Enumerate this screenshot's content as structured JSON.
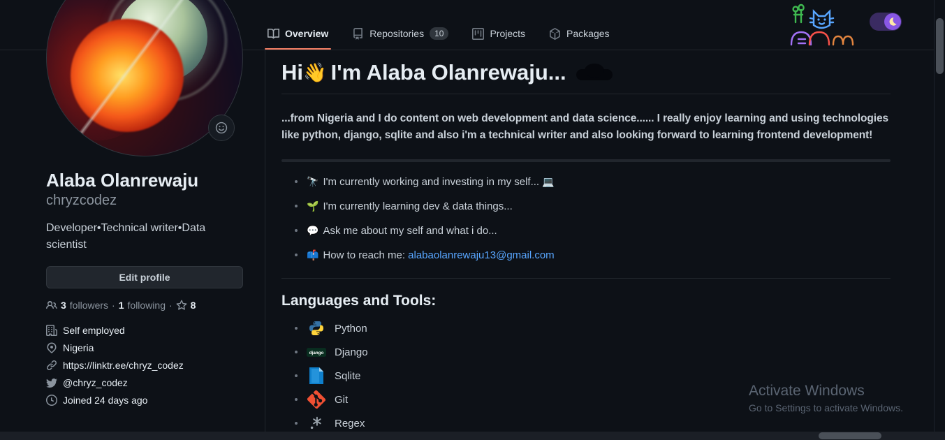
{
  "header": {
    "theme_toggle_icon": "moon-icon",
    "doodle_icon": "github-neon-doodle"
  },
  "nav": {
    "items": [
      {
        "label": "Overview",
        "icon": "book-icon",
        "badge": "",
        "active": true
      },
      {
        "label": "Repositories",
        "icon": "repo-icon",
        "badge": "10",
        "active": false
      },
      {
        "label": "Projects",
        "icon": "project-icon",
        "badge": "",
        "active": false
      },
      {
        "label": "Packages",
        "icon": "package-icon",
        "badge": "",
        "active": false
      }
    ]
  },
  "sidebar": {
    "avatar_alt": "fire-and-water-planet-avatar",
    "status_emoji_icon": "smiley-icon",
    "name": "Alaba Olanrewaju",
    "login": "chryzcodez",
    "bio": "Developer•Technical writer•Data scientist",
    "edit_profile_label": "Edit profile",
    "counters": {
      "followers_count": "3",
      "followers_label": "followers",
      "separator": "·",
      "following_count": "1",
      "following_label": "following",
      "stars_count": "8",
      "people_icon": "people-icon",
      "star_icon": "star-icon"
    },
    "meta": [
      {
        "icon": "organization-icon",
        "text": "Self employed"
      },
      {
        "icon": "location-icon",
        "text": "Nigeria"
      },
      {
        "icon": "link-icon",
        "text": "https://linktr.ee/chryz_codez"
      },
      {
        "icon": "twitter-icon",
        "text": "@chryz_codez"
      },
      {
        "icon": "clock-icon",
        "text": "Joined 24 days ago"
      }
    ]
  },
  "readme": {
    "heading_prefix": "Hi",
    "heading_emoji": "👋",
    "heading_text": "I'm Alaba Olanrewaju...",
    "heading_trailing_icon": "cloud-icon",
    "paragraph": "...from Nigeria and I do content on web development and data science...... I really enjoy learning and using technologies like python, django, sqlite and also i'm a technical writer and also looking forward to learning frontend development!",
    "bullets": [
      {
        "emoji": "🔭",
        "text": "I'm currently working and investing in my self...",
        "trailing_emoji": "💻",
        "link_text": "",
        "link_prefix": ""
      },
      {
        "emoji": "🌱",
        "text": "I'm currently learning dev & data things...",
        "trailing_emoji": "",
        "link_text": "",
        "link_prefix": ""
      },
      {
        "emoji": "💬",
        "text": "Ask me about my self and what i do...",
        "trailing_emoji": "",
        "link_text": "",
        "link_prefix": ""
      },
      {
        "emoji": "📫",
        "text": "",
        "trailing_emoji": "",
        "link_prefix": "How to reach me: ",
        "link_text": "alabaolanrewaju13@gmail.com"
      }
    ],
    "tools_heading": "Languages and Tools:",
    "tools": [
      {
        "name": "Python",
        "icon": "python-icon"
      },
      {
        "name": "Django",
        "icon": "django-icon"
      },
      {
        "name": "Sqlite",
        "icon": "sqlite-icon"
      },
      {
        "name": "Git",
        "icon": "git-icon"
      },
      {
        "name": "Regex",
        "icon": "regex-icon"
      }
    ]
  },
  "watermark": {
    "title": "Activate Windows",
    "subtitle": "Go to Settings to activate Windows."
  },
  "colors": {
    "background": "#0d1117",
    "border": "#21262d",
    "accent_underline": "#f78166",
    "link": "#58a6ff",
    "muted_text": "#8b949e",
    "toggle_purple": "#8957e5"
  }
}
